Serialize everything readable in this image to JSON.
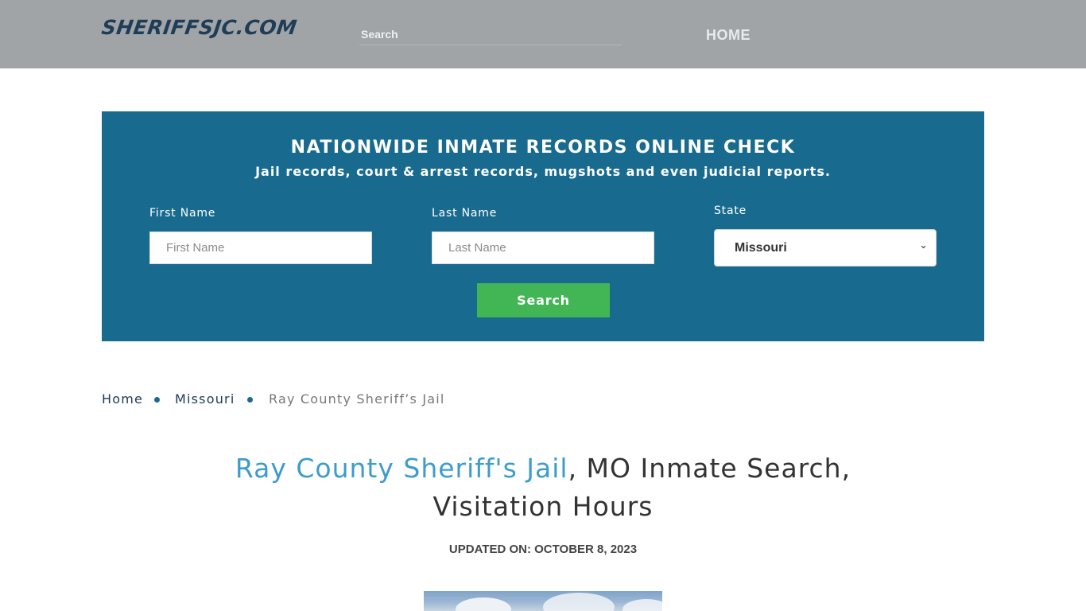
{
  "header": {
    "logo_text": "SHERIFFSJC.COM",
    "search_placeholder": "Search",
    "nav_home": "HOME"
  },
  "search_panel": {
    "title": "NATIONWIDE INMATE RECORDS ONLINE CHECK",
    "subtitle": "Jail records, court & arrest records, mugshots and even judicial reports.",
    "first_name_label": "First Name",
    "first_name_placeholder": "First Name",
    "last_name_label": "Last Name",
    "last_name_placeholder": "Last Name",
    "state_label": "State",
    "state_value": "Missouri",
    "search_button": "Search"
  },
  "breadcrumb": {
    "items": [
      "Home",
      "Missouri",
      "Ray County Sheriff’s Jail"
    ]
  },
  "page": {
    "title_highlight": "Ray County Sheriff's Jail",
    "title_rest_line1": ", MO Inmate Search,",
    "title_rest_line2": "Visitation Hours",
    "updated_label": "UPDATED ON:",
    "updated_date": "OCTOBER 8, 2023"
  },
  "colors": {
    "topbar": "#a0a4a7",
    "panel": "#186b8f",
    "button": "#42b655",
    "title_highlight": "#3d9ccc"
  }
}
